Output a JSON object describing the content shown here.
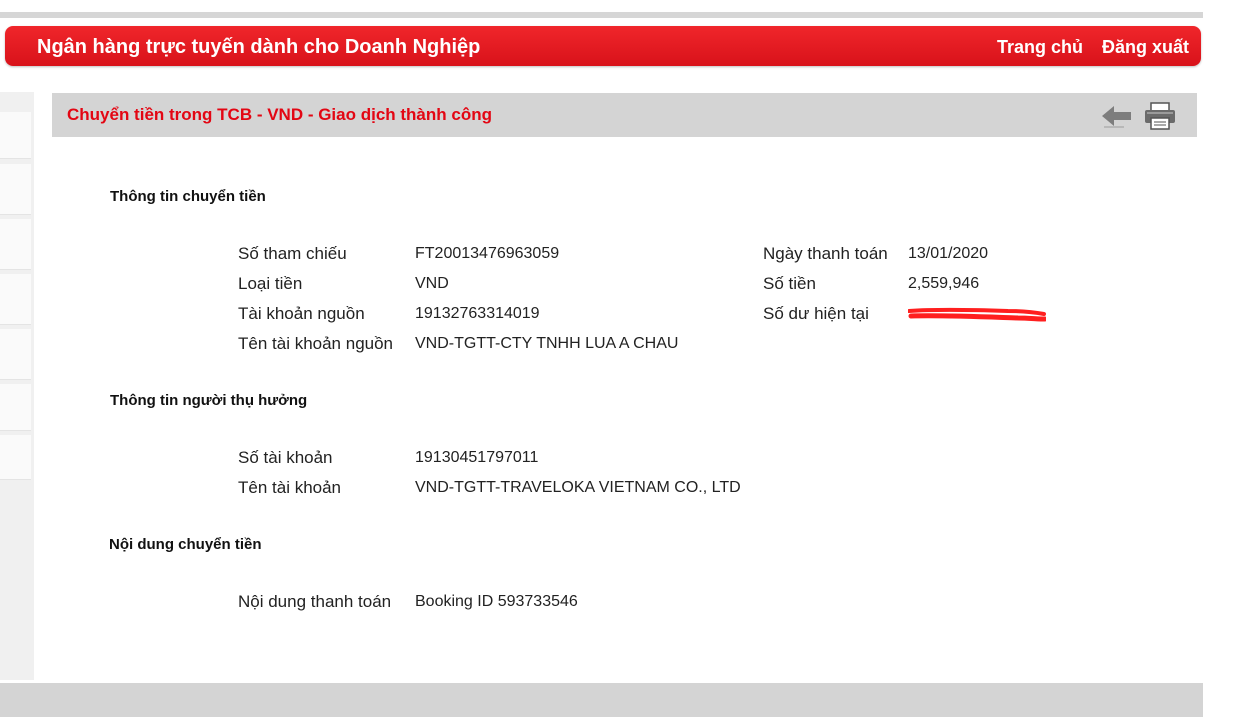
{
  "header": {
    "title": "Ngân hàng trực tuyến dành cho Doanh Nghiệp",
    "home_label": "Trang chủ",
    "logout_label": "Đăng xuất",
    "brand_color": "#e21a22"
  },
  "page": {
    "title": "Chuyển tiền trong TCB - VND - Giao dịch thành công",
    "title_color": "#e30613",
    "icons": [
      "back-arrow-icon",
      "printer-icon"
    ]
  },
  "transfer_info": {
    "section_title": "Thông tin chuyển tiền",
    "reference_label": "Số tham chiếu",
    "reference_value": "FT20013476963059",
    "currency_label": "Loại tiền",
    "currency_value": "VND",
    "source_account_label": "Tài khoản nguồn",
    "source_account_value": "19132763314019",
    "source_account_name_label": "Tên tài khoản nguồn",
    "source_account_name_value": "VND-TGTT-CTY TNHH LUA A CHAU",
    "payment_date_label": "Ngày thanh toán",
    "payment_date_value": "13/01/2020",
    "amount_label": "Số tiền",
    "amount_value": "2,559,946",
    "balance_label": "Số dư hiện tại"
  },
  "beneficiary_info": {
    "section_title": "Thông tin người thụ hưởng",
    "account_label": "Số tài khoản",
    "account_value": "19130451797011",
    "account_name_label": "Tên tài khoản",
    "account_name_value": "VND-TGTT-TRAVELOKA VIETNAM CO., LTD"
  },
  "transfer_content": {
    "section_title": "Nội dung chuyển tiền",
    "payment_content_label": "Nội dung thanh toán",
    "payment_content_value": "Booking ID 593733546"
  }
}
